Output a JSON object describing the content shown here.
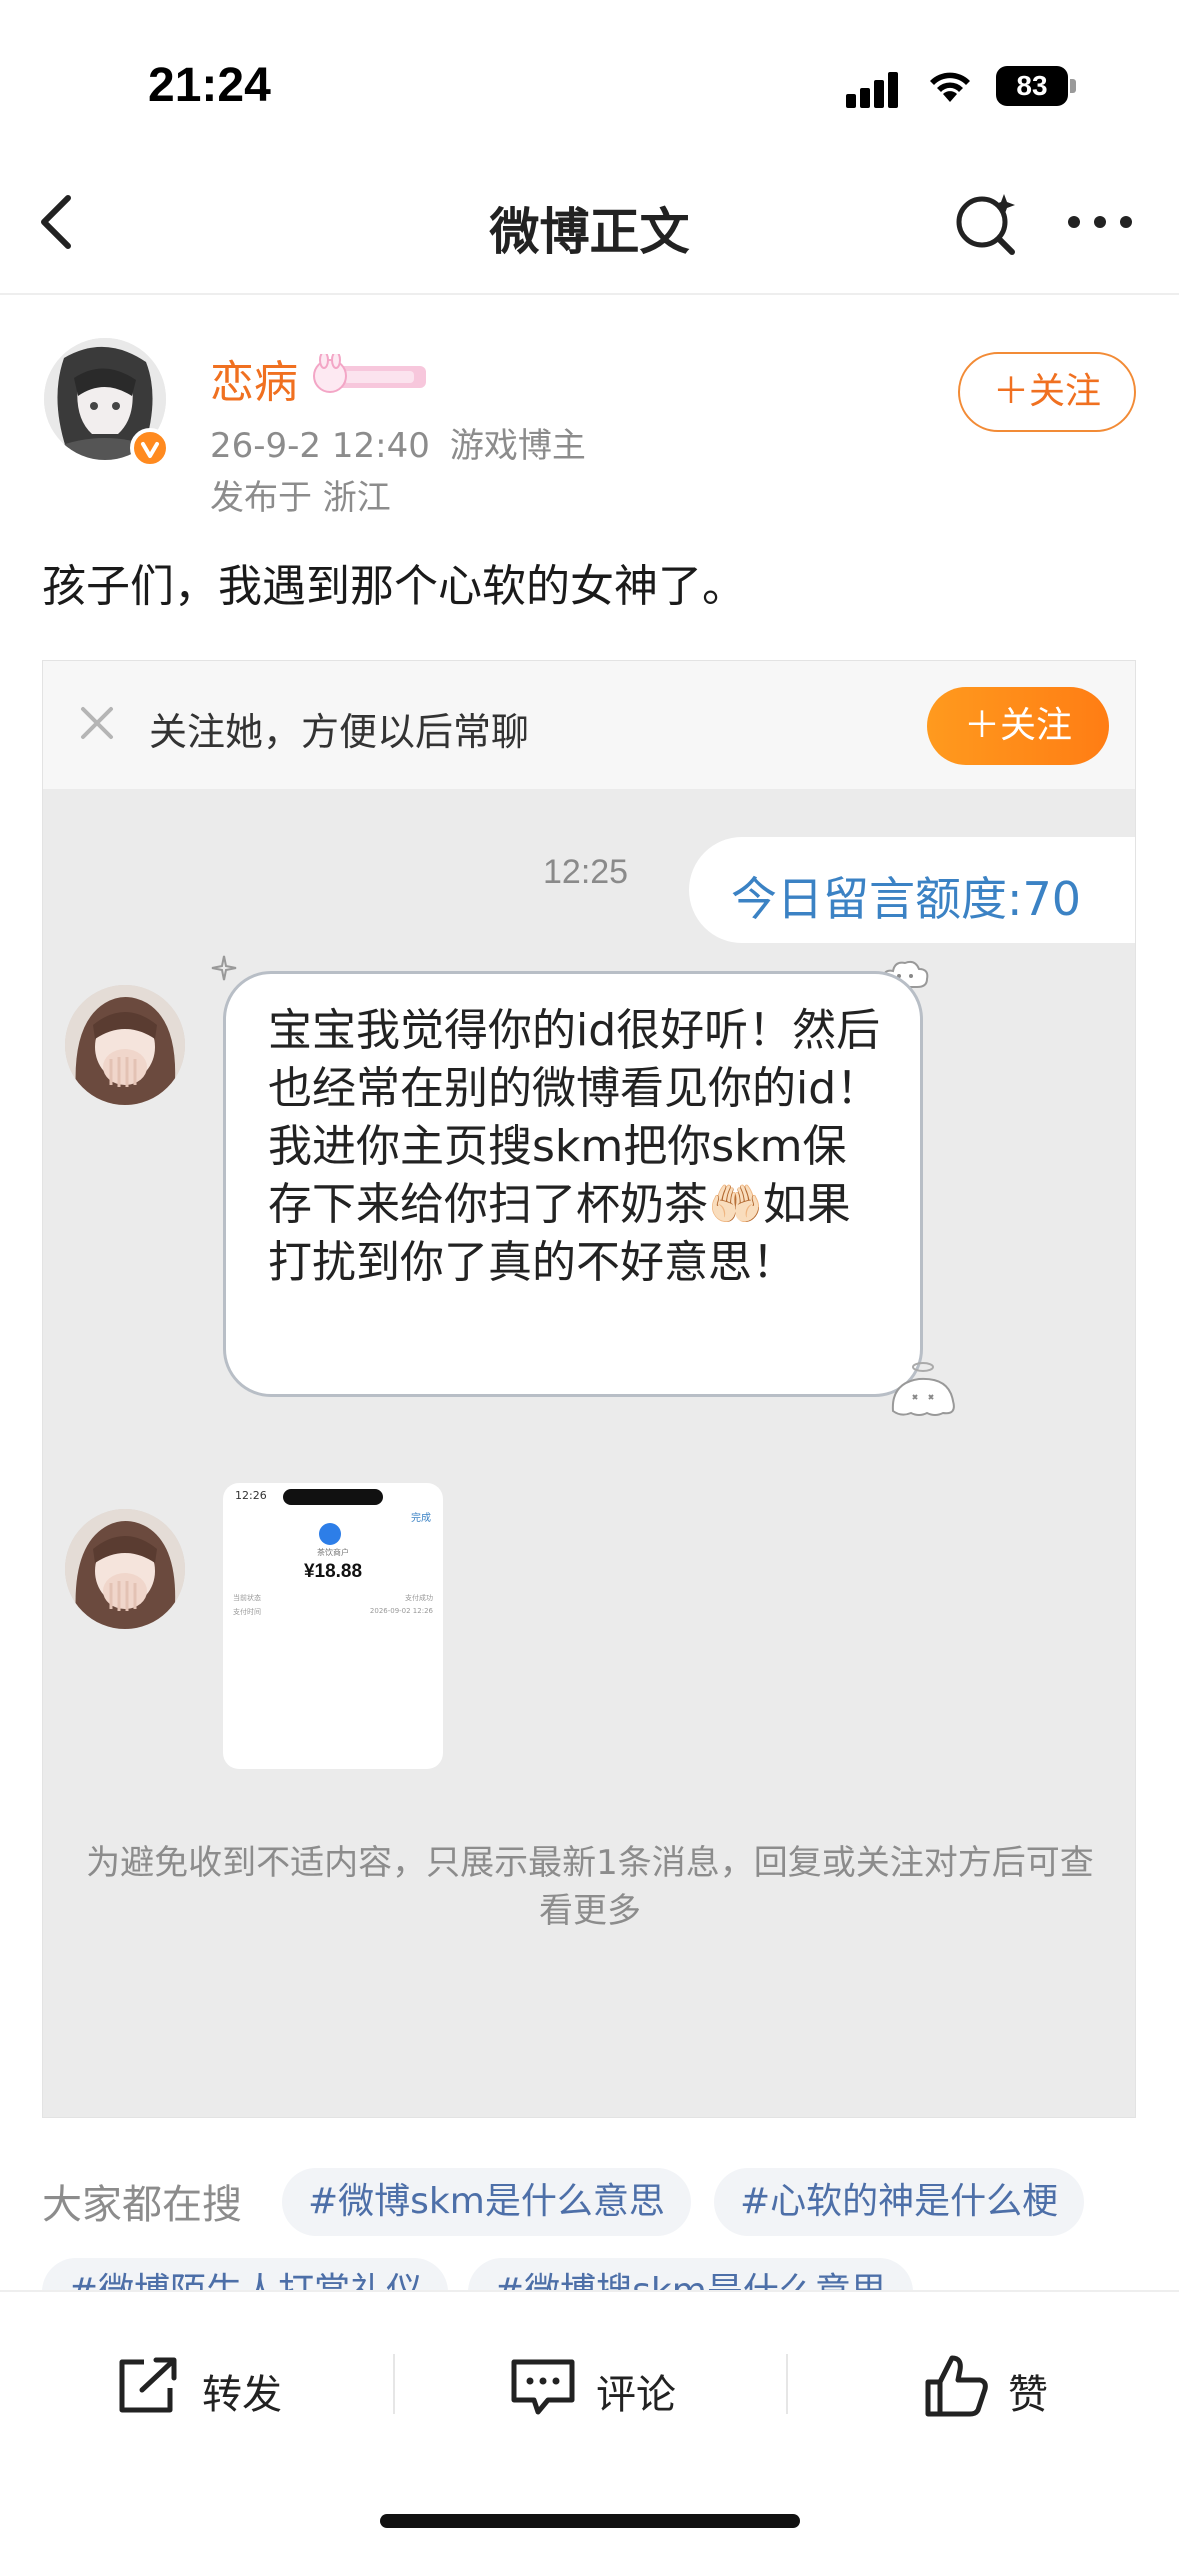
{
  "status_bar": {
    "time": "21:24",
    "battery": "83"
  },
  "nav": {
    "title": "微博正文"
  },
  "post": {
    "author": "恋病",
    "date": "26-9-2 12:40",
    "author_type": "游戏博主",
    "location": "发布于 浙江",
    "follow_label": "＋关注",
    "text": "孩子们，我遇到那个心软的女神了。"
  },
  "embed": {
    "banner_text": "关注她，方便以后常聊",
    "banner_follow": "＋关注",
    "chat_time": "12:25",
    "quota_text": "今日留言额度:70",
    "message": "宝宝我觉得你的id很好听！然后也经常在别的微博看见你的id！我进你主页搜skm把你skm保存下来给你扫了杯奶茶🤲🏻如果打扰到你了真的不好意思！",
    "receipt": {
      "time": "12:26",
      "done": "完成",
      "merchant": "茶饮商户",
      "amount": "¥18.88",
      "row1_label": "当前状态",
      "row1_value": "支付成功",
      "row2_label": "支付时间",
      "row2_value": "2026-09-02 12:26"
    },
    "disclaimer": "为避免收到不适内容，只展示最新1条消息，回复或关注对方后可查看更多"
  },
  "hot_search": {
    "label": "大家都在搜",
    "tags": [
      "#微博skm是什么意思",
      "#心软的神是什么梗",
      "#微博陌生人打赏礼仪",
      "#微博搜skm是什么意思"
    ]
  },
  "actions": {
    "forward": "转发",
    "comment": "评论",
    "like": "赞"
  },
  "colors": {
    "accent": "#f07020",
    "link": "#3b82c4",
    "tag_text": "#4d6fa8"
  }
}
